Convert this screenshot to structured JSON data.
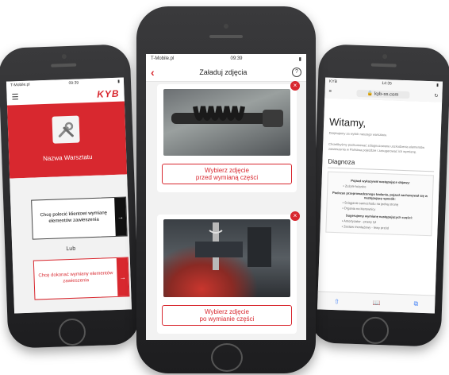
{
  "left_phone": {
    "status": {
      "carrier": "T-Mobile.pl",
      "time": "09:39",
      "battery": "▮"
    },
    "header": {
      "menu_icon": "hamburger-icon",
      "logo": "KYB"
    },
    "workshop_name": "Nazwa Warsztatu",
    "recommend_button": "Chcę polecić klientowi wymianę elementów zawieszenia",
    "or_label": "Lub",
    "replace_button": "Chcę dokonać wymiany elementów zawieszenia",
    "arrow": "→"
  },
  "center_phone": {
    "status": {
      "carrier": "T-Mobile.pl",
      "time": "09:39",
      "battery": "▮"
    },
    "back": "‹",
    "title": "Załaduj zdjęcia",
    "help": "?",
    "delete": "×",
    "pick_before": "Wybierz zdjęcie\nprzed wymianą części",
    "pick_after": "Wybierz zdjęcie\npo wymianie części"
  },
  "right_phone": {
    "status": {
      "carrier": "KYB",
      "time": "14:35",
      "battery": "▮"
    },
    "url_bar": {
      "left": "≡",
      "url": "🔒 kyb-ss.com",
      "reload": "↻"
    },
    "welcome": "Witamy,",
    "intro1": "Dziękujemy za wybór naszego warsztatu.",
    "intro2": "Chcielibyśmy podsumować zdiagnozowane uszkodzenia elementów zawieszenia w Państwa pojeździe i zasugerować ich wymianę.",
    "diagnosis_heading": "Diagnoza",
    "section1": "Pojazd wykazywał następujące objawy:",
    "items1": [
      "Zużyte łożysko"
    ],
    "section2": "Podczas przeprowadzonego badania, pojazd zachowywał się w następujący sposób:",
    "items2": [
      "Ściąganie samochodu na jedną stronę",
      "Drgania na kierownicy"
    ],
    "section3": "Sugerujemy wymianę następujących części:",
    "items3": [
      "Amortyzator - prawy tył",
      "Zestaw montażowy - lewy przód"
    ],
    "toolbar": [
      "⇧",
      "📖",
      "⧉"
    ]
  }
}
